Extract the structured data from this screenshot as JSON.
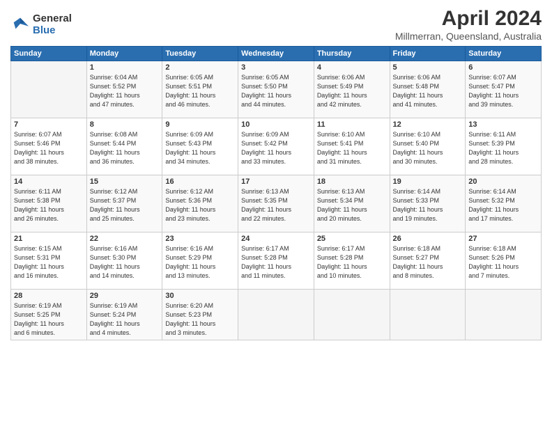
{
  "header": {
    "logo_line1": "General",
    "logo_line2": "Blue",
    "month_title": "April 2024",
    "location": "Millmerran, Queensland, Australia"
  },
  "weekdays": [
    "Sunday",
    "Monday",
    "Tuesday",
    "Wednesday",
    "Thursday",
    "Friday",
    "Saturday"
  ],
  "weeks": [
    [
      {
        "day": "",
        "info": ""
      },
      {
        "day": "1",
        "info": "Sunrise: 6:04 AM\nSunset: 5:52 PM\nDaylight: 11 hours\nand 47 minutes."
      },
      {
        "day": "2",
        "info": "Sunrise: 6:05 AM\nSunset: 5:51 PM\nDaylight: 11 hours\nand 46 minutes."
      },
      {
        "day": "3",
        "info": "Sunrise: 6:05 AM\nSunset: 5:50 PM\nDaylight: 11 hours\nand 44 minutes."
      },
      {
        "day": "4",
        "info": "Sunrise: 6:06 AM\nSunset: 5:49 PM\nDaylight: 11 hours\nand 42 minutes."
      },
      {
        "day": "5",
        "info": "Sunrise: 6:06 AM\nSunset: 5:48 PM\nDaylight: 11 hours\nand 41 minutes."
      },
      {
        "day": "6",
        "info": "Sunrise: 6:07 AM\nSunset: 5:47 PM\nDaylight: 11 hours\nand 39 minutes."
      }
    ],
    [
      {
        "day": "7",
        "info": "Sunrise: 6:07 AM\nSunset: 5:46 PM\nDaylight: 11 hours\nand 38 minutes."
      },
      {
        "day": "8",
        "info": "Sunrise: 6:08 AM\nSunset: 5:44 PM\nDaylight: 11 hours\nand 36 minutes."
      },
      {
        "day": "9",
        "info": "Sunrise: 6:09 AM\nSunset: 5:43 PM\nDaylight: 11 hours\nand 34 minutes."
      },
      {
        "day": "10",
        "info": "Sunrise: 6:09 AM\nSunset: 5:42 PM\nDaylight: 11 hours\nand 33 minutes."
      },
      {
        "day": "11",
        "info": "Sunrise: 6:10 AM\nSunset: 5:41 PM\nDaylight: 11 hours\nand 31 minutes."
      },
      {
        "day": "12",
        "info": "Sunrise: 6:10 AM\nSunset: 5:40 PM\nDaylight: 11 hours\nand 30 minutes."
      },
      {
        "day": "13",
        "info": "Sunrise: 6:11 AM\nSunset: 5:39 PM\nDaylight: 11 hours\nand 28 minutes."
      }
    ],
    [
      {
        "day": "14",
        "info": "Sunrise: 6:11 AM\nSunset: 5:38 PM\nDaylight: 11 hours\nand 26 minutes."
      },
      {
        "day": "15",
        "info": "Sunrise: 6:12 AM\nSunset: 5:37 PM\nDaylight: 11 hours\nand 25 minutes."
      },
      {
        "day": "16",
        "info": "Sunrise: 6:12 AM\nSunset: 5:36 PM\nDaylight: 11 hours\nand 23 minutes."
      },
      {
        "day": "17",
        "info": "Sunrise: 6:13 AM\nSunset: 5:35 PM\nDaylight: 11 hours\nand 22 minutes."
      },
      {
        "day": "18",
        "info": "Sunrise: 6:13 AM\nSunset: 5:34 PM\nDaylight: 11 hours\nand 20 minutes."
      },
      {
        "day": "19",
        "info": "Sunrise: 6:14 AM\nSunset: 5:33 PM\nDaylight: 11 hours\nand 19 minutes."
      },
      {
        "day": "20",
        "info": "Sunrise: 6:14 AM\nSunset: 5:32 PM\nDaylight: 11 hours\nand 17 minutes."
      }
    ],
    [
      {
        "day": "21",
        "info": "Sunrise: 6:15 AM\nSunset: 5:31 PM\nDaylight: 11 hours\nand 16 minutes."
      },
      {
        "day": "22",
        "info": "Sunrise: 6:16 AM\nSunset: 5:30 PM\nDaylight: 11 hours\nand 14 minutes."
      },
      {
        "day": "23",
        "info": "Sunrise: 6:16 AM\nSunset: 5:29 PM\nDaylight: 11 hours\nand 13 minutes."
      },
      {
        "day": "24",
        "info": "Sunrise: 6:17 AM\nSunset: 5:28 PM\nDaylight: 11 hours\nand 11 minutes."
      },
      {
        "day": "25",
        "info": "Sunrise: 6:17 AM\nSunset: 5:28 PM\nDaylight: 11 hours\nand 10 minutes."
      },
      {
        "day": "26",
        "info": "Sunrise: 6:18 AM\nSunset: 5:27 PM\nDaylight: 11 hours\nand 8 minutes."
      },
      {
        "day": "27",
        "info": "Sunrise: 6:18 AM\nSunset: 5:26 PM\nDaylight: 11 hours\nand 7 minutes."
      }
    ],
    [
      {
        "day": "28",
        "info": "Sunrise: 6:19 AM\nSunset: 5:25 PM\nDaylight: 11 hours\nand 6 minutes."
      },
      {
        "day": "29",
        "info": "Sunrise: 6:19 AM\nSunset: 5:24 PM\nDaylight: 11 hours\nand 4 minutes."
      },
      {
        "day": "30",
        "info": "Sunrise: 6:20 AM\nSunset: 5:23 PM\nDaylight: 11 hours\nand 3 minutes."
      },
      {
        "day": "",
        "info": ""
      },
      {
        "day": "",
        "info": ""
      },
      {
        "day": "",
        "info": ""
      },
      {
        "day": "",
        "info": ""
      }
    ]
  ]
}
